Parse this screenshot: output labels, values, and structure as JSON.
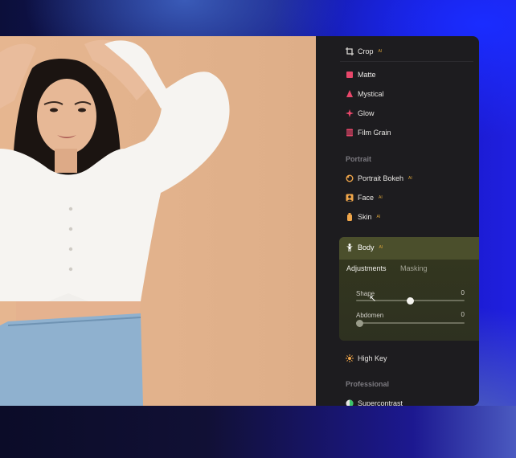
{
  "panel": {
    "crop": {
      "label": "Crop",
      "icon": "crop-icon",
      "badge": "AI"
    },
    "effects": [
      {
        "label": "Matte",
        "icon": "matte-icon",
        "color": "#e8476a"
      },
      {
        "label": "Mystical",
        "icon": "mystical-icon",
        "color": "#e8476a"
      },
      {
        "label": "Glow",
        "icon": "glow-icon",
        "color": "#e8476a"
      },
      {
        "label": "Film Grain",
        "icon": "film-grain-icon",
        "color": "#e8476a"
      }
    ],
    "portrait_section": "Portrait",
    "portrait_items": [
      {
        "label": "Portrait Bokeh",
        "icon": "portrait-bokeh-icon",
        "badge": "AI"
      },
      {
        "label": "Face",
        "icon": "face-icon",
        "badge": "AI"
      },
      {
        "label": "Skin",
        "icon": "skin-icon",
        "badge": "AI"
      }
    ],
    "body": {
      "label": "Body",
      "icon": "body-icon",
      "badge": "AI",
      "tabs": [
        "Adjustments",
        "Masking"
      ],
      "active_tab": "Adjustments",
      "sliders": [
        {
          "label": "Shape",
          "value": "0",
          "level": 0.5
        },
        {
          "label": "Abdomen",
          "value": "0",
          "level": 0.0
        }
      ]
    },
    "high_key": {
      "label": "High Key",
      "icon": "high-key-icon"
    },
    "professional_section": "Professional",
    "supercontrast": {
      "label": "Supercontrast",
      "icon": "supercontrast-icon"
    }
  },
  "colors": {
    "accent_orange": "#f0a64a",
    "ai_badge": "#d8a23a",
    "panel_bg": "#1d1c1f",
    "photo_bg": "#e3b58f"
  }
}
